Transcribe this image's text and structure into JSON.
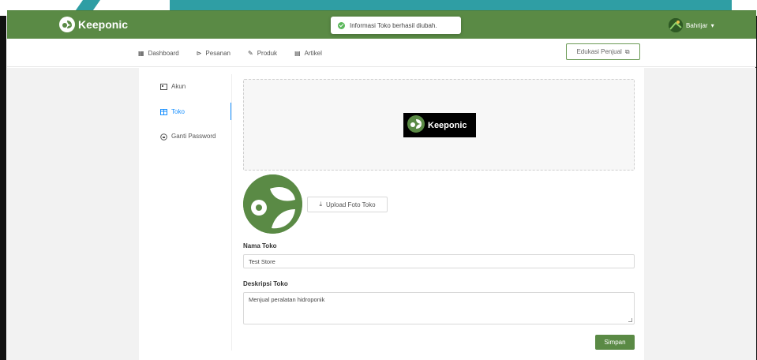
{
  "app": {
    "brand_name": "Keeponic"
  },
  "toast": {
    "message": "Informasi Toko berhasil diubah."
  },
  "user": {
    "name": "Bahrijar"
  },
  "nav": {
    "items": [
      {
        "label": "Dashboard",
        "icon": "dashboard-icon"
      },
      {
        "label": "Pesanan",
        "icon": "orders-icon"
      },
      {
        "label": "Produk",
        "icon": "edit-icon"
      },
      {
        "label": "Artikel",
        "icon": "article-icon"
      }
    ],
    "edu_label": "Edukasi Penjual"
  },
  "sidebar": {
    "items": [
      {
        "label": "Akun",
        "icon": "account-icon",
        "active": false
      },
      {
        "label": "Toko",
        "icon": "store-icon",
        "active": true
      },
      {
        "label": "Ganti Password",
        "icon": "lock-icon",
        "active": false
      }
    ]
  },
  "banner": {
    "logo_text": "Keeponic"
  },
  "upload": {
    "label": "Upload Foto Toko"
  },
  "form": {
    "name_label": "Nama Toko",
    "name_value": "Test Store",
    "desc_label": "Deskripsi Toko",
    "desc_value": "Menjual peralatan hidroponik",
    "save_label": "Simpan"
  },
  "colors": {
    "primary_green": "#5a8a45",
    "active_blue": "#1890ff"
  }
}
